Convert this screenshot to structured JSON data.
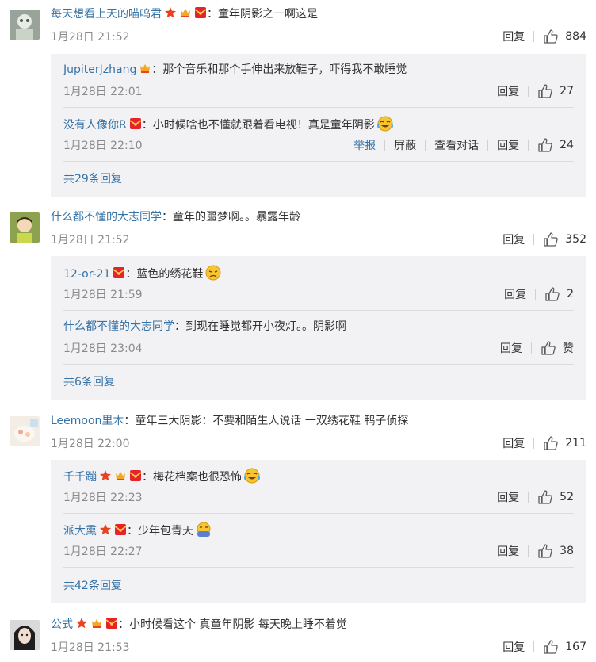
{
  "colors": {
    "link": "#3572a5",
    "meta": "#8a8a8a",
    "reply_bg": "#f2f2f5"
  },
  "labels": {
    "reply": "回复",
    "report": "举报",
    "block": "屏蔽",
    "view_conversation": "查看对话"
  },
  "comments": [
    {
      "avatar": "avatar-1",
      "user": "每天想看上天的喵呜君",
      "badges": [
        "star-badge-icon",
        "crown-badge-icon",
        "redpacket-badge-icon"
      ],
      "text": "：童年阴影之一啊这是",
      "time": "1月28日 21:52",
      "likes": "884",
      "replies": [
        {
          "user": "JupiterJzhang",
          "badges": [
            "crown-badge-icon"
          ],
          "text": "：那个音乐和那个手伸出来放鞋子，吓得我不敢睡觉",
          "time": "1月28日 22:01",
          "likes": "27"
        },
        {
          "user": "没有人像你R",
          "badges": [
            "redpacket-badge-icon"
          ],
          "text": "：小时候啥也不懂就跟着看电视！真是童年阴影",
          "emoji": "crying-laughing-emoji",
          "time": "1月28日 22:10",
          "likes": "24",
          "extra_actions": true
        }
      ],
      "more": "共29条回复"
    },
    {
      "avatar": "avatar-2",
      "user": "什么都不懂的大志同学",
      "badges": [],
      "text": "：童年的噩梦啊。。暴露年龄",
      "time": "1月28日 21:52",
      "likes": "352",
      "replies": [
        {
          "user": "12-or-21",
          "badges": [
            "redpacket-badge-icon"
          ],
          "text": "：蓝色的绣花鞋",
          "emoji": "sad-face-emoji",
          "time": "1月28日 21:59",
          "likes": "2"
        },
        {
          "user": "什么都不懂的大志同学",
          "badges": [],
          "text": "：到现在睡觉都开小夜灯。。阴影啊",
          "time": "1月28日 23:04",
          "likes": "赞"
        }
      ],
      "more": "共6条回复"
    },
    {
      "avatar": "avatar-3",
      "user": "Leemoon里木",
      "badges": [],
      "text": "：童年三大阴影：不要和陌生人说话  一双绣花鞋  鸭子侦探",
      "time": "1月28日 22:00",
      "likes": "211",
      "replies": [
        {
          "user": "千千蹦",
          "badges": [
            "star-badge-icon",
            "crown-badge-icon",
            "redpacket-badge-icon"
          ],
          "text": "：梅花档案也很恐怖",
          "emoji": "crying-laughing-emoji",
          "time": "1月28日 22:23",
          "likes": "52"
        },
        {
          "user": "派大熏",
          "badges": [
            "star-badge-icon",
            "redpacket-badge-icon"
          ],
          "text": "：少年包青天",
          "emoji": "cover-face-emoji",
          "time": "1月28日 22:27",
          "likes": "38"
        }
      ],
      "more": "共42条回复"
    },
    {
      "avatar": "avatar-4",
      "user": "公式",
      "badges": [
        "star-badge-icon",
        "crown-badge-icon",
        "redpacket-badge-icon"
      ],
      "text": "：小时候看这个 真童年阴影 每天晚上睡不着觉",
      "time": "1月28日 21:53",
      "likes": "167",
      "replies": [],
      "more": ""
    }
  ]
}
